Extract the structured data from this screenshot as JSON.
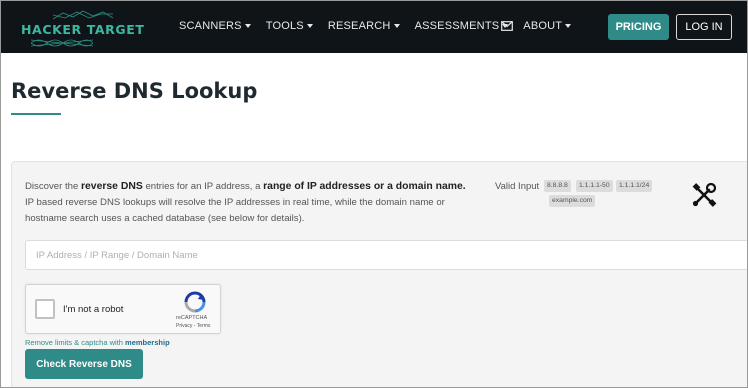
{
  "nav": {
    "logo_text": "HACKER TARGET",
    "menu": [
      {
        "label": "SCANNERS"
      },
      {
        "label": "TOOLS"
      },
      {
        "label": "RESEARCH"
      },
      {
        "label": "ASSESSMENTS"
      },
      {
        "label": "ABOUT"
      }
    ],
    "mail_icon": "envelope-icon",
    "pricing_label": "PRICING",
    "login_label": "LOG IN"
  },
  "page": {
    "title": "Reverse DNS Lookup"
  },
  "panel": {
    "desc_part1": "Discover the ",
    "desc_bold1": "reverse DNS",
    "desc_part2": " entries for an IP address, a ",
    "desc_bold2": "range of IP addresses or a domain name.",
    "desc_part3": "IP based reverse DNS lookups will resolve the IP addresses in real time, while the domain name or hostname search uses a cached database (see below for details).",
    "valid_input_label": "Valid Input",
    "valid_examples": [
      "8.8.8.8",
      "1.1.1.1-50",
      "1.1.1.1/24",
      "example.com"
    ],
    "tools_icon": "wrench-screwdriver-icon",
    "input_placeholder": "IP Address / IP Range / Domain Name",
    "input_value": "",
    "captcha": {
      "label": "I'm not a robot",
      "brand": "reCAPTCHA",
      "links": "Privacy - Terms"
    },
    "limits_text": "Remove limits & captcha with ",
    "limits_link": "membership",
    "submit_label": "Check Reverse DNS"
  },
  "colors": {
    "nav_bg": "#0f1419",
    "accent": "#2e8b87",
    "logo": "#3db8a0",
    "panel_bg": "#f4f4f4"
  }
}
